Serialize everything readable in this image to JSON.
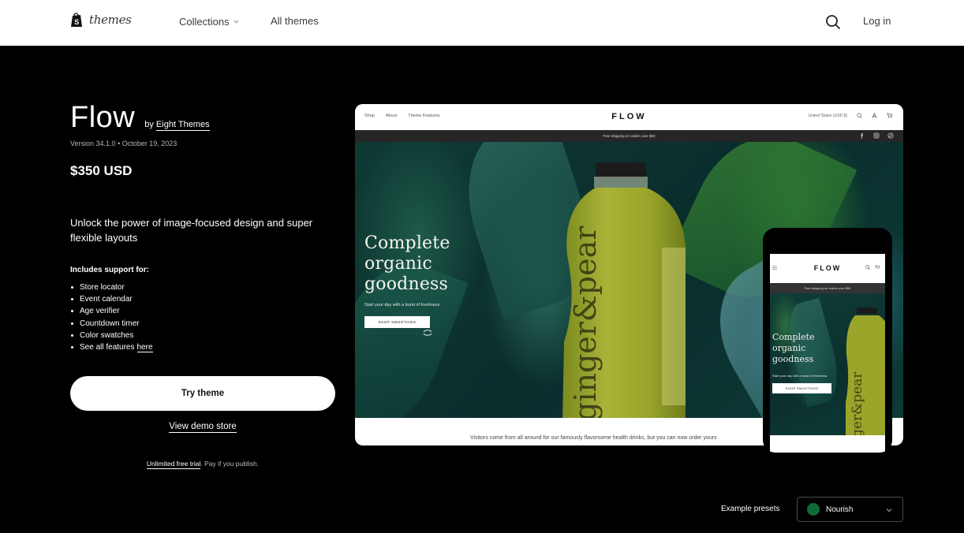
{
  "topnav": {
    "logo_text": "themes",
    "collections_label": "Collections",
    "all_themes_label": "All themes",
    "login_label": "Log in"
  },
  "theme": {
    "name": "Flow",
    "by_prefix": "by",
    "author": "Eight Themes",
    "version": "Version 34.1.0",
    "separator": "•",
    "date": "October 19, 2023",
    "price": "$350 USD",
    "tagline": "Unlock the power of image-focused design and super flexible layouts",
    "support_heading": "Includes support for:",
    "features": [
      "Store locator",
      "Event calendar",
      "Age verifier",
      "Countdown timer",
      "Color swatches"
    ],
    "see_all_prefix": "See all features",
    "see_all_link": "here"
  },
  "actions": {
    "try_theme": "Try theme",
    "view_demo": "View demo store",
    "trial_link": "Unlimited free trial",
    "trial_suffix": ". Pay if you publish."
  },
  "preview": {
    "nav_links": [
      "Shop",
      "About",
      "Theme Features"
    ],
    "logo": "FLOW",
    "currency": "United States (USD $)",
    "announcement": "Free shipping on orders over $50",
    "headline_lines": [
      "Complete",
      "organic",
      "goodness"
    ],
    "subheadline": "Start your day with a burst of freshness",
    "cta": "SHOP SMOOTHIES",
    "bottle_label": "ginger&pear",
    "caption": "Visitors come from all around for our famously flavorsome health drinks, but you can now order yours"
  },
  "mobile_preview": {
    "logo": "FLOW",
    "announcement": "Free shipping on orders over $50",
    "headline_lines": [
      "Complete",
      "organic",
      "goodness"
    ],
    "subheadline": "Start your day with a burst of freshness",
    "cta": "SHOP SMOOTHIES"
  },
  "presets": {
    "label": "Example presets",
    "selected": "Nourish",
    "selected_color": "#0f6b35"
  },
  "colors": {
    "page_bg": "#000000",
    "nav_bg": "#ffffff",
    "announcement_bar": "#262626",
    "bottle_green": "#9aa52a"
  }
}
